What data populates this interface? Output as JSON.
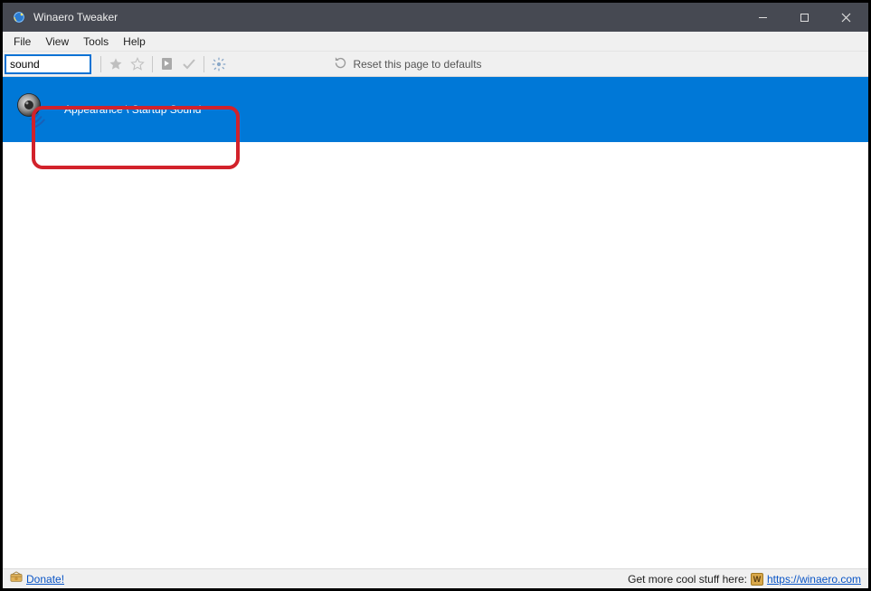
{
  "window": {
    "title": "Winaero Tweaker"
  },
  "menu": {
    "file": "File",
    "view": "View",
    "tools": "Tools",
    "help": "Help"
  },
  "toolbar": {
    "search_value": "sound",
    "reset_label": "Reset this page to defaults"
  },
  "results": {
    "items": [
      {
        "label": "Appearance \\ Startup Sound"
      }
    ]
  },
  "statusbar": {
    "donate_label": "Donate!",
    "promo_text": "Get more cool stuff here: ",
    "promo_url_text": "https://winaero.com"
  }
}
